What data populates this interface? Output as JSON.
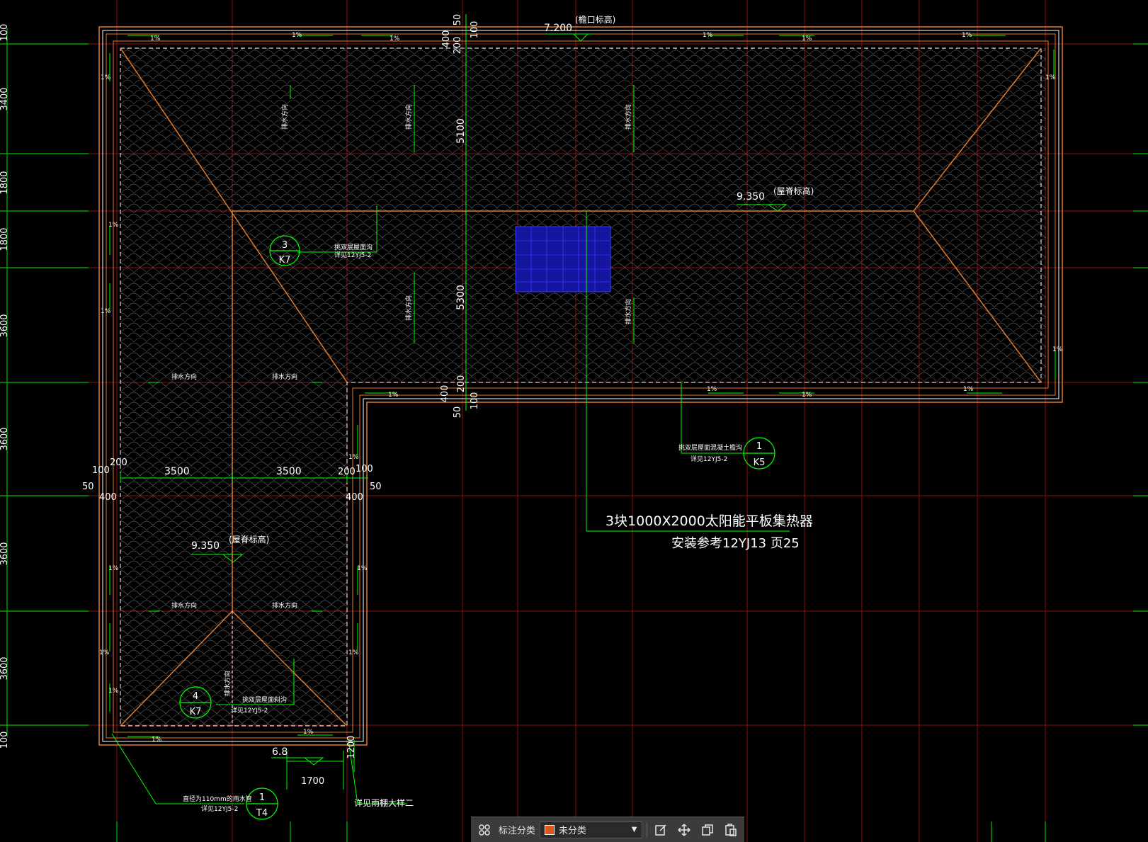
{
  "colors": {
    "background": "#000000",
    "grid_red": "#8a1010",
    "grid_green": "#00c000",
    "roof_outline": "#e07a2a",
    "drawing_white": "#ffffff",
    "solar_panel": "#1515a0",
    "dim_green": "#00ff00",
    "toolbar_bg": "#3b3b3b"
  },
  "drawing": {
    "left_axis_dims": [
      "3400",
      "1800",
      "1800",
      "3600",
      "3600",
      "3600",
      "3600",
      "100",
      "100"
    ],
    "eave_elevation": "7.200",
    "eave_note": "(檐口标高)",
    "ridge_elevation_top": "9.350",
    "ridge_note_top": "(屋脊标高)",
    "ridge_elevation_left": "9.350",
    "ridge_note_left": "(屋脊标高)",
    "canopy_elevation": "6.8",
    "vertical_dims": [
      "50",
      "100",
      "200",
      "400",
      "5100",
      "5300",
      "200",
      "400",
      "100",
      "50"
    ],
    "horizontal_dims": [
      "100",
      "200",
      "3500",
      "3500",
      "200",
      "100",
      "50",
      "400",
      "400",
      "50"
    ],
    "canopy_dims": [
      "1700",
      "1200"
    ],
    "slope_label": "1%",
    "drain_label": "排水方向",
    "solar_label": "3块1000X2000太阳能平板集热器",
    "solar_ref": "安装参考12YJ13 页25",
    "callout_k7_top": {
      "num": "3",
      "sheet": "K7",
      "line1": "挑双层屋面沟",
      "line2": "详见12YJ5-2"
    },
    "callout_k5": {
      "num": "1",
      "sheet": "K5",
      "line1": "挑双层屋面混凝土檐沟",
      "line2": "详见12YJ5-2"
    },
    "callout_k7_bottom": {
      "num": "4",
      "sheet": "K7",
      "line1": "挑双层屋面斜沟",
      "line2": "详见12YJ5-2"
    },
    "callout_t4": {
      "num": "1",
      "sheet": "T4",
      "line1": "直径为110mm的雨水管",
      "line2": "详见12YJ5-2"
    },
    "canopy_note": "详见雨棚大样二"
  },
  "toolbar": {
    "grid_icon": "grid-icon",
    "label": "标注分类",
    "category": "未分类",
    "category_color": "#e0571c",
    "icons": [
      "edit-icon",
      "move-icon",
      "copy-icon",
      "paste-icon"
    ]
  }
}
